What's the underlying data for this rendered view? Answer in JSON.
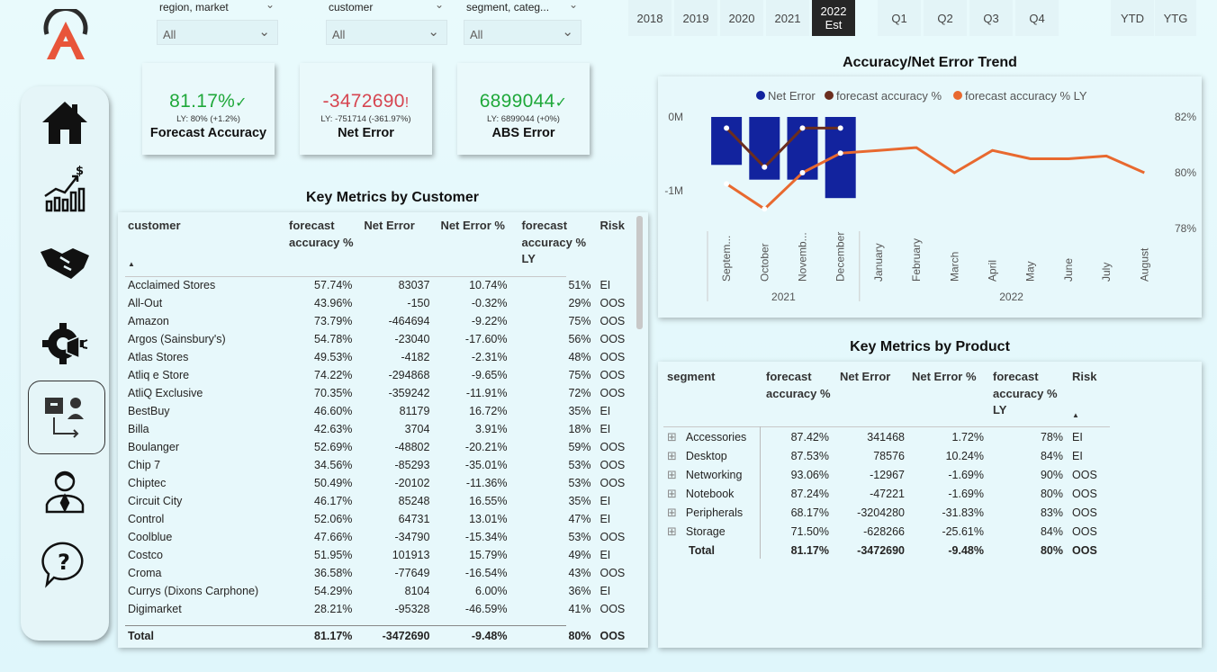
{
  "slicers": [
    {
      "label": "region, market",
      "value": "All"
    },
    {
      "label": "customer",
      "value": "All"
    },
    {
      "label": "segment, categ...",
      "value": "All"
    }
  ],
  "years": [
    "2018",
    "2019",
    "2020",
    "2021"
  ],
  "selected_year": {
    "line1": "2022",
    "line2": "Est"
  },
  "quarters": [
    "Q1",
    "Q2",
    "Q3",
    "Q4"
  ],
  "periods": [
    "YTD",
    "YTG"
  ],
  "kpis": [
    {
      "value": "81.17%",
      "mark": "✓",
      "ly": "LY: 80% (+1.2%)",
      "title": "Forecast Accuracy",
      "color": "#1fa83a"
    },
    {
      "value": "-3472690",
      "mark": "!",
      "ly": "LY: -751714 (-361.97%)",
      "title": "Net Error",
      "color": "#d64550"
    },
    {
      "value": "6899044",
      "mark": "✓",
      "ly": "LY: 6899044 (+0%)",
      "title": "ABS Error",
      "color": "#1fa83a"
    }
  ],
  "customer_table": {
    "title": "Key Metrics by Customer",
    "headers": [
      "customer",
      "forecast accuracy %",
      "Net Error",
      "Net Error %",
      "forecast accuracy % LY",
      "Risk"
    ],
    "rows": [
      [
        "Acclaimed Stores",
        "57.74%",
        "83037",
        "10.74%",
        "51%",
        "EI"
      ],
      [
        "All-Out",
        "43.96%",
        "-150",
        "-0.32%",
        "29%",
        "OOS"
      ],
      [
        "Amazon",
        "73.79%",
        "-464694",
        "-9.22%",
        "75%",
        "OOS"
      ],
      [
        "Argos (Sainsbury's)",
        "54.78%",
        "-23040",
        "-17.60%",
        "56%",
        "OOS"
      ],
      [
        "Atlas Stores",
        "49.53%",
        "-4182",
        "-2.31%",
        "48%",
        "OOS"
      ],
      [
        "Atliq e Store",
        "74.22%",
        "-294868",
        "-9.65%",
        "75%",
        "OOS"
      ],
      [
        "AtliQ Exclusive",
        "70.35%",
        "-359242",
        "-11.91%",
        "72%",
        "OOS"
      ],
      [
        "BestBuy",
        "46.60%",
        "81179",
        "16.72%",
        "35%",
        "EI"
      ],
      [
        "Billa",
        "42.63%",
        "3704",
        "3.91%",
        "18%",
        "EI"
      ],
      [
        "Boulanger",
        "52.69%",
        "-48802",
        "-20.21%",
        "59%",
        "OOS"
      ],
      [
        "Chip 7",
        "34.56%",
        "-85293",
        "-35.01%",
        "53%",
        "OOS"
      ],
      [
        "Chiptec",
        "50.49%",
        "-20102",
        "-11.36%",
        "53%",
        "OOS"
      ],
      [
        "Circuit City",
        "46.17%",
        "85248",
        "16.55%",
        "35%",
        "EI"
      ],
      [
        "Control",
        "52.06%",
        "64731",
        "13.01%",
        "47%",
        "EI"
      ],
      [
        "Coolblue",
        "47.66%",
        "-34790",
        "-15.34%",
        "53%",
        "OOS"
      ],
      [
        "Costco",
        "51.95%",
        "101913",
        "15.79%",
        "49%",
        "EI"
      ],
      [
        "Croma",
        "36.58%",
        "-77649",
        "-16.54%",
        "43%",
        "OOS"
      ],
      [
        "Currys (Dixons Carphone)",
        "54.29%",
        "8104",
        "6.00%",
        "36%",
        "EI"
      ],
      [
        "Digimarket",
        "28.21%",
        "-95328",
        "-46.59%",
        "41%",
        "OOS"
      ]
    ],
    "total": [
      "Total",
      "81.17%",
      "-3472690",
      "-9.48%",
      "80%",
      "OOS"
    ]
  },
  "product_table": {
    "title": "Key Metrics by Product",
    "headers": [
      "segment",
      "forecast accuracy %",
      "Net Error",
      "Net Error %",
      "forecast accuracy % LY",
      "Risk"
    ],
    "rows": [
      [
        "Accessories",
        "87.42%",
        "341468",
        "1.72%",
        "78%",
        "EI"
      ],
      [
        "Desktop",
        "87.53%",
        "78576",
        "10.24%",
        "84%",
        "EI"
      ],
      [
        "Networking",
        "93.06%",
        "-12967",
        "-1.69%",
        "90%",
        "OOS"
      ],
      [
        "Notebook",
        "87.24%",
        "-47221",
        "-1.69%",
        "80%",
        "OOS"
      ],
      [
        "Peripherals",
        "68.17%",
        "-3204280",
        "-31.83%",
        "83%",
        "OOS"
      ],
      [
        "Storage",
        "71.50%",
        "-628266",
        "-25.61%",
        "84%",
        "OOS"
      ]
    ],
    "total": [
      "Total",
      "81.17%",
      "-3472690",
      "-9.48%",
      "80%",
      "OOS"
    ]
  },
  "chart_data": {
    "type": "bar",
    "title": "Accuracy/Net Error Trend",
    "legend": [
      "Net Error",
      "forecast accuracy %",
      "forecast accuracy % LY"
    ],
    "legend_position": "top",
    "colors": {
      "net_error": "#12239e",
      "accuracy": "#6b2e1f",
      "accuracy_ly": "#e8692f"
    },
    "categories": [
      "Septem...",
      "October",
      "Novemb...",
      "December",
      "January",
      "February",
      "March",
      "April",
      "May",
      "June",
      "July",
      "August"
    ],
    "year_groups": [
      {
        "label": "2021",
        "span": 4
      },
      {
        "label": "2022",
        "span": 8
      }
    ],
    "y_left": {
      "ticks": [
        "0M",
        "-1M"
      ],
      "range": [
        -1.1,
        0.1
      ]
    },
    "y_right": {
      "ticks": [
        "82%",
        "80%",
        "78%"
      ],
      "range": [
        77.2,
        82.2
      ]
    },
    "series": [
      {
        "name": "Net Error",
        "axis": "left",
        "values": [
          -0.65,
          -0.85,
          -0.85,
          -1.1,
          null,
          null,
          null,
          null,
          null,
          null,
          null,
          null
        ]
      },
      {
        "name": "forecast accuracy %",
        "axis": "right",
        "values": [
          81.6,
          80.2,
          81.6,
          81.6,
          null,
          null,
          null,
          null,
          null,
          null,
          null,
          null
        ]
      },
      {
        "name": "forecast accuracy % LY",
        "axis": "right",
        "values": [
          79.6,
          78.7,
          80.0,
          80.7,
          80.8,
          80.9,
          80.0,
          80.8,
          80.5,
          80.5,
          80.6,
          80.0
        ]
      }
    ]
  }
}
